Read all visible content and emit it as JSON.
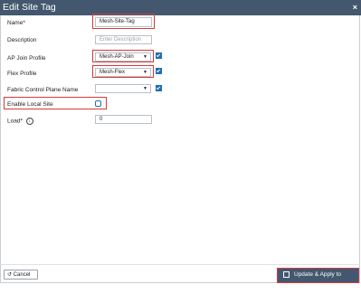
{
  "window": {
    "title": "Edit Site Tag",
    "close_glyph": "×"
  },
  "form": {
    "name": {
      "label": "Name*",
      "value": "Mesh-Site-Tag"
    },
    "description": {
      "label": "Description",
      "placeholder": "Enter Description"
    },
    "ap_join_profile": {
      "label": "AP Join Profile",
      "value": "Mesh-AP-Join"
    },
    "flex_profile": {
      "label": "Flex Profile",
      "value": "Mesh-Flex"
    },
    "fabric_cp": {
      "label": "Fabric Control Plane Name",
      "value": ""
    },
    "enable_local_site": {
      "label": "Enable Local Site",
      "checked": false
    },
    "load": {
      "label": "Load*",
      "value": "0",
      "help_icon": "info-icon"
    }
  },
  "footer": {
    "cancel_label": "Cancel",
    "apply_label": "Update & Apply to Device"
  },
  "colors": {
    "titlebar": "#43586e",
    "highlight": "#d33b3b",
    "accent": "#1f6fb5"
  }
}
